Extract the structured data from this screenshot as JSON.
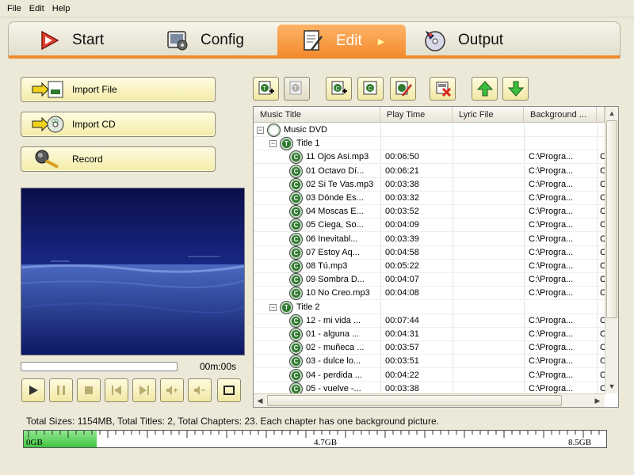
{
  "menu": [
    "File",
    "Edit",
    "Help"
  ],
  "tabs": {
    "start": "Start",
    "config": "Config",
    "edit": "Edit",
    "output": "Output"
  },
  "actions": {
    "import_file": "Import File",
    "import_cd": "Import CD",
    "record": "Record"
  },
  "player": {
    "time": "00m:00s",
    "progress": 0
  },
  "list": {
    "columns": [
      "Music Title",
      "Play Time",
      "Lyric File",
      "Background ..."
    ],
    "root": "Music DVD",
    "titles": [
      {
        "name": "Title 1",
        "tracks": [
          {
            "title": "11 Ojos Asi.mp3",
            "time": "00:06:50",
            "bg": "C:\\Progra..."
          },
          {
            "title": "01 Octavo Dí...",
            "time": "00:06:21",
            "bg": "C:\\Progra..."
          },
          {
            "title": "02 Si Te Vas.mp3",
            "time": "00:03:38",
            "bg": "C:\\Progra..."
          },
          {
            "title": "03 Dónde Es...",
            "time": "00:03:32",
            "bg": "C:\\Progra..."
          },
          {
            "title": "04 Moscas E...",
            "time": "00:03:52",
            "bg": "C:\\Progra..."
          },
          {
            "title": "05 Ciega, So...",
            "time": "00:04:09",
            "bg": "C:\\Progra..."
          },
          {
            "title": "06 Inevitabl...",
            "time": "00:03:39",
            "bg": "C:\\Progra..."
          },
          {
            "title": "07 Estoy Aq...",
            "time": "00:04:58",
            "bg": "C:\\Progra..."
          },
          {
            "title": "08 Tú.mp3",
            "time": "00:05:22",
            "bg": "C:\\Progra..."
          },
          {
            "title": "09 Sombra D...",
            "time": "00:04:07",
            "bg": "C:\\Progra..."
          },
          {
            "title": "10 No Creo.mp3",
            "time": "00:04:08",
            "bg": "C:\\Progra..."
          }
        ]
      },
      {
        "name": "Title 2",
        "tracks": [
          {
            "title": "12 - mi vida ...",
            "time": "00:07:44",
            "bg": "C:\\Progra..."
          },
          {
            "title": "01 - alguna ...",
            "time": "00:04:31",
            "bg": "C:\\Progra..."
          },
          {
            "title": "02 - muñeca ...",
            "time": "00:03:57",
            "bg": "C:\\Progra..."
          },
          {
            "title": "03 - dulce lo...",
            "time": "00:03:51",
            "bg": "C:\\Progra..."
          },
          {
            "title": "04 - perdida ...",
            "time": "00:04:22",
            "bg": "C:\\Progra..."
          },
          {
            "title": "05 - vuelve -...",
            "time": "00:03:38",
            "bg": "C:\\Progra..."
          }
        ]
      }
    ],
    "fifth_col_char": "C"
  },
  "summary": "Total Sizes: 1154MB, Total Titles: 2, Total Chapters: 23. Each chapter has one background picture.",
  "capacity": {
    "labels": [
      "0GB",
      "4.7GB",
      "8.5GB"
    ],
    "used_fraction": 0.125
  },
  "colors": {
    "accent": "#f08a2c",
    "track_icon": "#2f7a2f",
    "capacity_fill": "#43c443"
  }
}
